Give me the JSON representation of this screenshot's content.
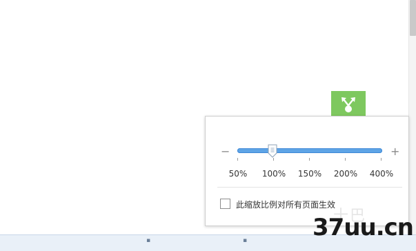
{
  "zoom": {
    "minus_symbol": "−",
    "plus_symbol": "+",
    "stops": [
      "50%",
      "100%",
      "150%",
      "200%",
      "400%"
    ],
    "current_value": "100%",
    "apply_all_label": "此缩放比例对所有页面生效",
    "apply_all_checked": false
  },
  "watermark": {
    "text": "37uu.cn",
    "cn_text": "十巴"
  },
  "colors": {
    "slider_track": "#5ea4e6",
    "tile_green": "#7ec85f"
  },
  "icons": {
    "tile_icon": "share-arrows-icon"
  }
}
